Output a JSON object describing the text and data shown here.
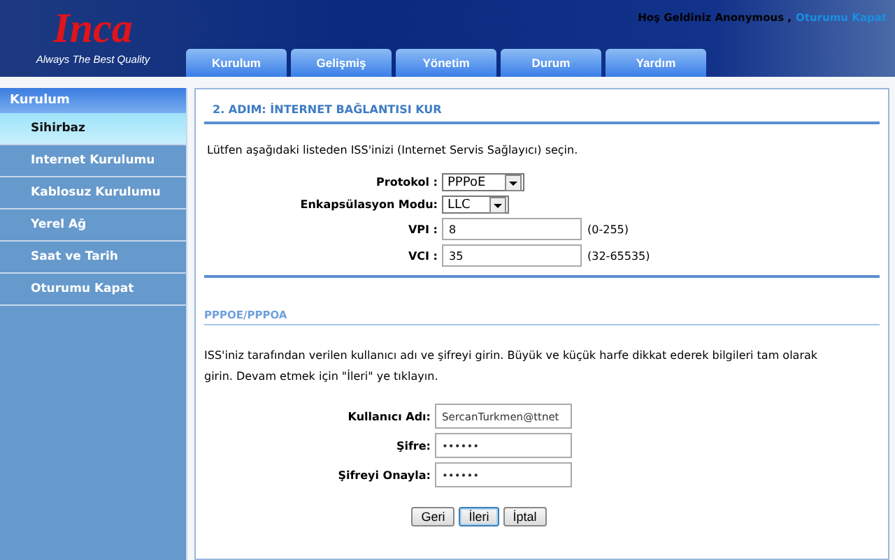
{
  "header": {
    "logo": "Inca",
    "tagline": "Always The Best Quality",
    "welcome": "Hoş Geldiniz Anonymous ,",
    "logout": "Oturumu Kapat"
  },
  "tabs": [
    {
      "label": "Kurulum",
      "selected": false
    },
    {
      "label": "Gelişmiş",
      "selected": false
    },
    {
      "label": "Yönetim",
      "selected": false
    },
    {
      "label": "Durum",
      "selected": false
    },
    {
      "label": "Yardım",
      "selected": false
    }
  ],
  "sidebar": {
    "title": "Kurulum",
    "items": [
      {
        "label": "Sihirbaz",
        "selected": true
      },
      {
        "label": "Internet Kurulumu",
        "selected": false
      },
      {
        "label": "Kablosuz Kurulumu",
        "selected": false
      },
      {
        "label": "Yerel Ağ",
        "selected": false
      },
      {
        "label": "Saat ve Tarih",
        "selected": false
      },
      {
        "label": "Oturumu Kapat",
        "selected": false
      }
    ]
  },
  "step": {
    "title": "2. ADIM: İNTERNET BAĞLANTISI KUR",
    "intro": "Lütfen aşağıdaki listeden ISS'inizi (Internet Servis Sağlayıcı) seçin.",
    "fields": [
      {
        "kind": "select",
        "label": "Protokol :",
        "value": "PPPoE"
      },
      {
        "kind": "select",
        "label": "Enkapsülasyon Modu:",
        "value": "LLC"
      },
      {
        "kind": "input",
        "label": "VPI :",
        "value": "8",
        "hint": "(0-255)"
      },
      {
        "kind": "input",
        "label": "VCI :",
        "value": "35",
        "hint": "(32-65535)"
      }
    ]
  },
  "pppoe": {
    "title": "PPPOE/PPPOA",
    "text": "ISS'iniz tarafından verilen kullanıcı adı ve şifreyi girin. Büyük ve küçük harfe dikkat ederek bilgileri tam olarak girin. Devam etmek için \"İleri\" ye tıklayın.",
    "fields": [
      {
        "label": "Kullanıcı Adı:",
        "value": "SercanTurkmen@ttnet"
      },
      {
        "label": "Şifre:",
        "value": "••••••"
      },
      {
        "label": "Şifreyi Onayla:",
        "value": "••••••"
      }
    ]
  },
  "buttons": [
    {
      "label": "Geri",
      "focused": false
    },
    {
      "label": "İleri",
      "focused": true
    },
    {
      "label": "İptal",
      "focused": false
    }
  ]
}
